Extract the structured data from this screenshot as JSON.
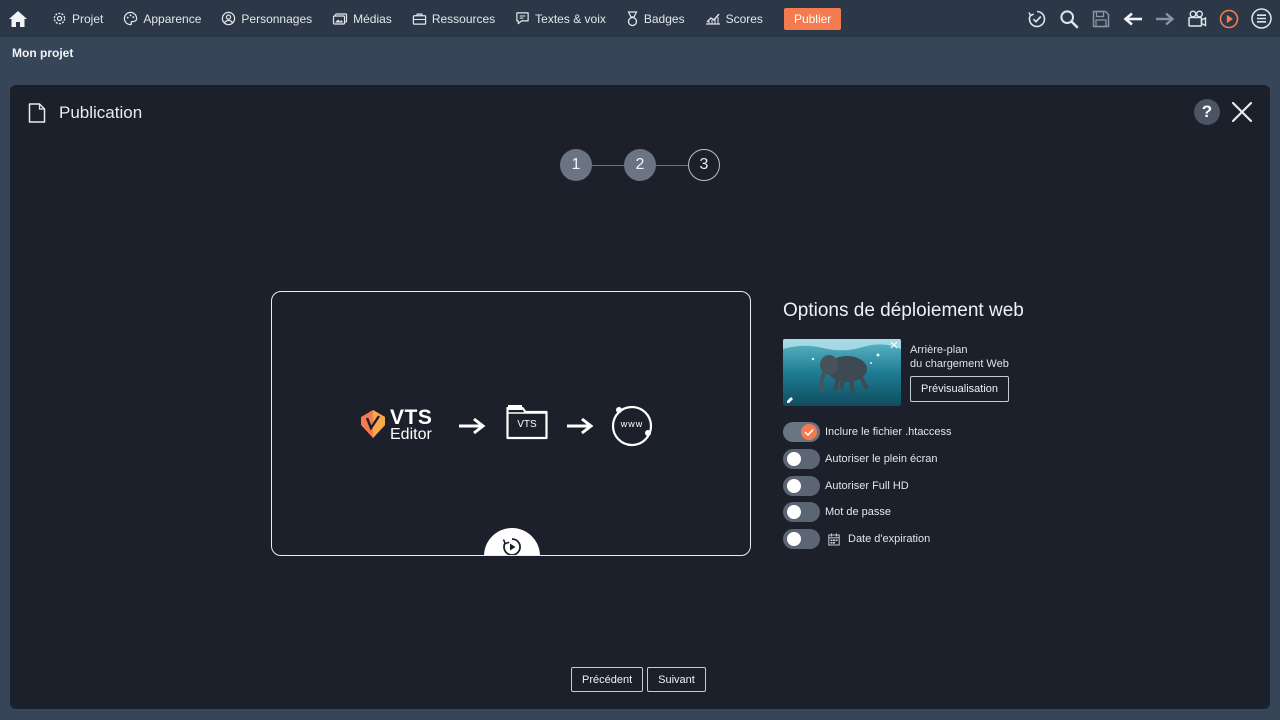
{
  "menu": {
    "items": [
      {
        "label": "Projet",
        "icon": "gear-icon"
      },
      {
        "label": "Apparence",
        "icon": "palette-icon"
      },
      {
        "label": "Personnages",
        "icon": "user-icon"
      },
      {
        "label": "Médias",
        "icon": "media-icon"
      },
      {
        "label": "Ressources",
        "icon": "briefcase-icon"
      },
      {
        "label": "Textes & voix",
        "icon": "speech-icon"
      },
      {
        "label": "Badges",
        "icon": "badge-icon"
      },
      {
        "label": "Scores",
        "icon": "chart-icon"
      }
    ],
    "publish_label": "Publier"
  },
  "project": {
    "name": "Mon projet"
  },
  "dialog": {
    "title": "Publication",
    "help_label": "?",
    "steps": [
      "1",
      "2",
      "3"
    ],
    "current_step": 2,
    "preview": {
      "logo_main": "VTS",
      "logo_sub": "Editor",
      "folder_label": "VTS",
      "web_label": "www"
    },
    "options": {
      "title": "Options de déploiement web",
      "background_label_line1": "Arrière-plan",
      "background_label_line2": "du chargement Web",
      "preview_button": "Prévisualisation",
      "toggles": [
        {
          "label": "Inclure le fichier .htaccess",
          "on": true
        },
        {
          "label": "Autoriser le plein écran",
          "on": false
        },
        {
          "label": "Autoriser Full HD",
          "on": false
        },
        {
          "label": "Mot de passe",
          "on": false
        },
        {
          "label": "Date d'expiration",
          "on": false
        }
      ]
    },
    "nav": {
      "previous": "Précédent",
      "next": "Suivant"
    }
  },
  "colors": {
    "accent": "#f47b4f",
    "topbar": "#2c3847",
    "background": "#374558",
    "panel": "#1b202a"
  }
}
